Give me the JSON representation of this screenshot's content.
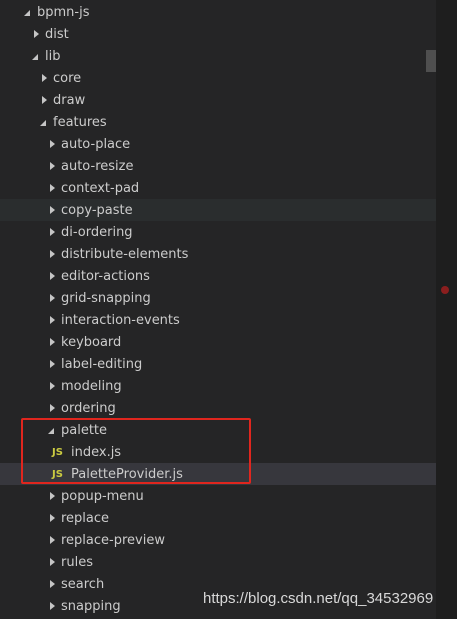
{
  "tree": {
    "items": [
      {
        "label": "bpmn-js",
        "depth": 0,
        "type": "folder",
        "expanded": true
      },
      {
        "label": "dist",
        "depth": 1,
        "type": "folder",
        "expanded": false
      },
      {
        "label": "lib",
        "depth": 1,
        "type": "folder",
        "expanded": true
      },
      {
        "label": "core",
        "depth": 2,
        "type": "folder",
        "expanded": false
      },
      {
        "label": "draw",
        "depth": 2,
        "type": "folder",
        "expanded": false
      },
      {
        "label": "features",
        "depth": 2,
        "type": "folder",
        "expanded": true
      },
      {
        "label": "auto-place",
        "depth": 3,
        "type": "folder",
        "expanded": false
      },
      {
        "label": "auto-resize",
        "depth": 3,
        "type": "folder",
        "expanded": false
      },
      {
        "label": "context-pad",
        "depth": 3,
        "type": "folder",
        "expanded": false
      },
      {
        "label": "copy-paste",
        "depth": 3,
        "type": "folder",
        "expanded": false,
        "state": "hover"
      },
      {
        "label": "di-ordering",
        "depth": 3,
        "type": "folder",
        "expanded": false
      },
      {
        "label": "distribute-elements",
        "depth": 3,
        "type": "folder",
        "expanded": false
      },
      {
        "label": "editor-actions",
        "depth": 3,
        "type": "folder",
        "expanded": false
      },
      {
        "label": "grid-snapping",
        "depth": 3,
        "type": "folder",
        "expanded": false
      },
      {
        "label": "interaction-events",
        "depth": 3,
        "type": "folder",
        "expanded": false
      },
      {
        "label": "keyboard",
        "depth": 3,
        "type": "folder",
        "expanded": false
      },
      {
        "label": "label-editing",
        "depth": 3,
        "type": "folder",
        "expanded": false
      },
      {
        "label": "modeling",
        "depth": 3,
        "type": "folder",
        "expanded": false
      },
      {
        "label": "ordering",
        "depth": 3,
        "type": "folder",
        "expanded": false
      },
      {
        "label": "palette",
        "depth": 3,
        "type": "folder",
        "expanded": true
      },
      {
        "label": "index.js",
        "depth": 4,
        "type": "js-file"
      },
      {
        "label": "PaletteProvider.js",
        "depth": 4,
        "type": "js-file",
        "state": "selected"
      },
      {
        "label": "popup-menu",
        "depth": 3,
        "type": "folder",
        "expanded": false
      },
      {
        "label": "replace",
        "depth": 3,
        "type": "folder",
        "expanded": false
      },
      {
        "label": "replace-preview",
        "depth": 3,
        "type": "folder",
        "expanded": false
      },
      {
        "label": "rules",
        "depth": 3,
        "type": "folder",
        "expanded": false
      },
      {
        "label": "search",
        "depth": 3,
        "type": "folder",
        "expanded": false
      },
      {
        "label": "snapping",
        "depth": 3,
        "type": "folder",
        "expanded": false
      }
    ],
    "js_icon_text": "JS"
  },
  "watermark": "https://blog.csdn.net/qq_34532969",
  "colors": {
    "background": "#252526",
    "text": "#cccccc",
    "js_icon": "#cbcb41",
    "highlight_box": "#e0261e",
    "selected_row": "#37373d",
    "hover_row": "#2a2d2e"
  }
}
